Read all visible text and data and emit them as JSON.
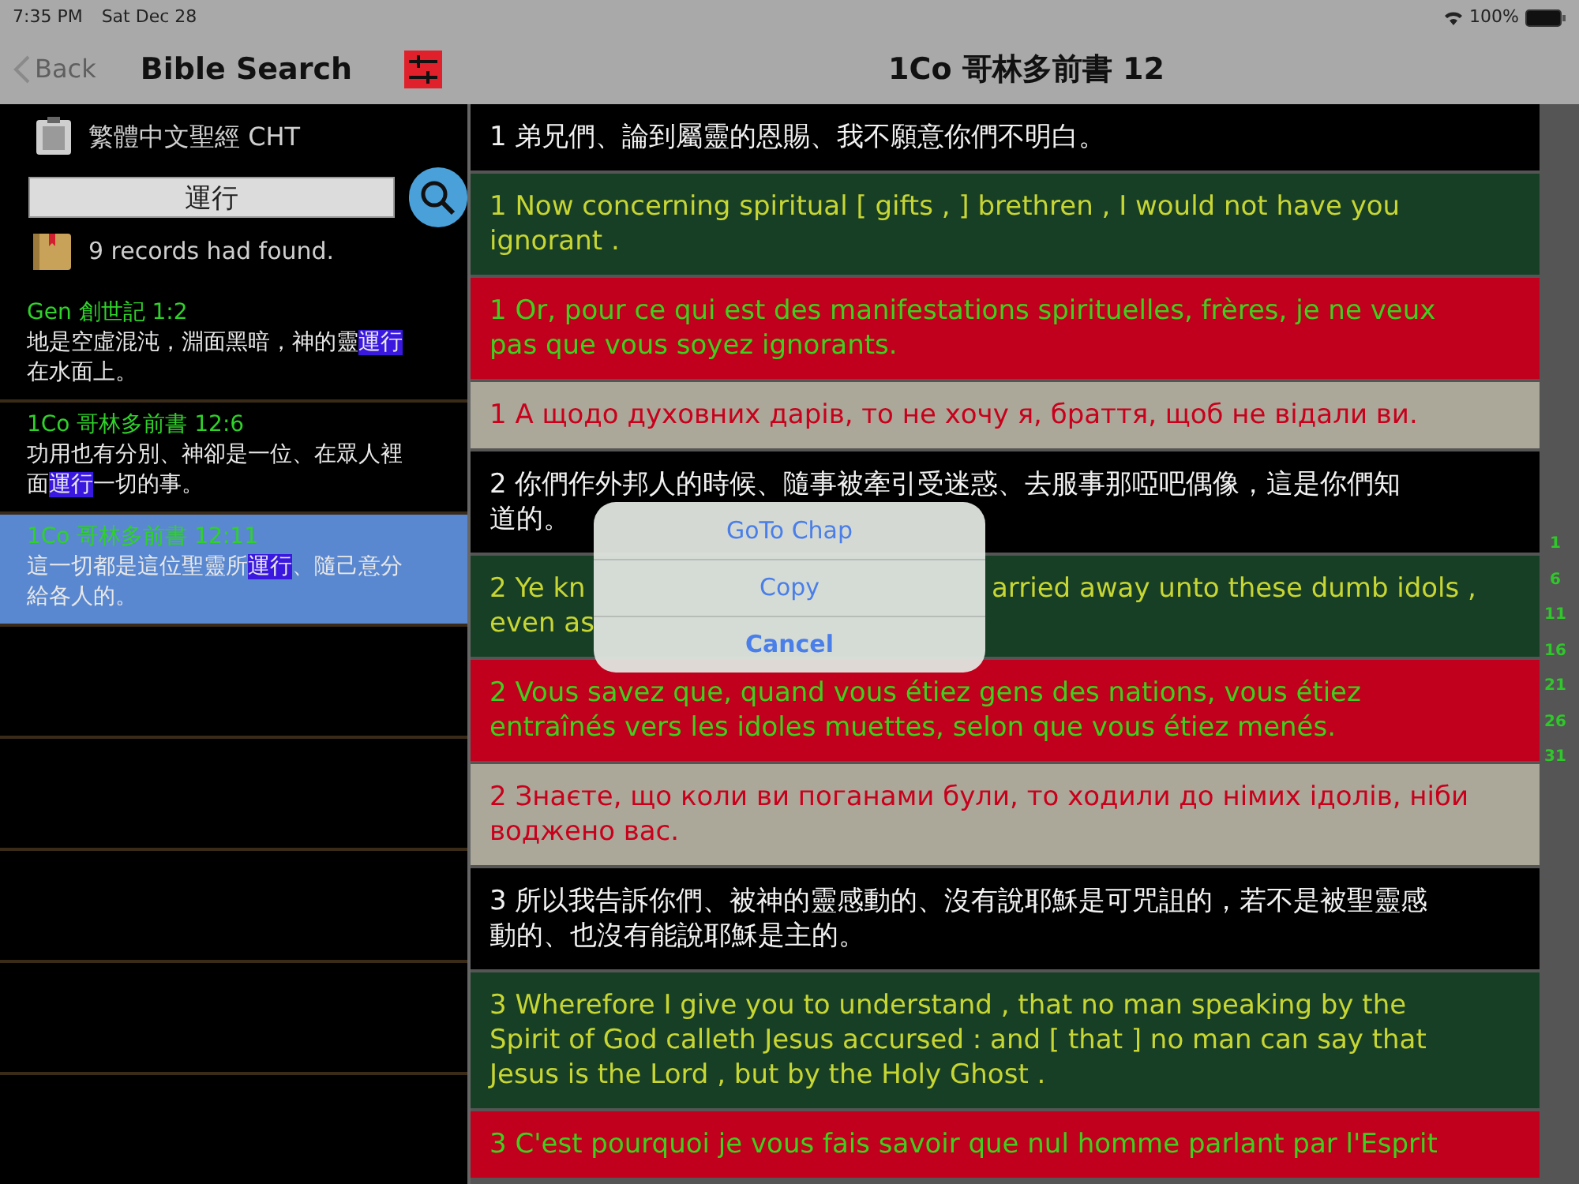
{
  "status_bar": {
    "time": "7:35 PM",
    "date": "Sat Dec 28",
    "battery": "100%"
  },
  "sidebar": {
    "back": "Back",
    "title": "Bible Search",
    "version": "繁體中文聖經 CHT",
    "search": {
      "value": "運行"
    },
    "records": "9 records had found.",
    "results": [
      {
        "ref": "Gen 創世記 1:2",
        "before": "地是空虛混沌，淵面黑暗，神的靈",
        "match": "運行",
        "after": "在水面上。",
        "selected": false
      },
      {
        "ref": "1Co 哥林多前書 12:6",
        "before": "功用也有分別、神卻是一位、在眾人裡面",
        "match": "運行",
        "after": "一切的事。",
        "selected": false
      },
      {
        "ref": "1Co 哥林多前書 12:11",
        "before": "這一切都是這位聖靈所",
        "match": "運行",
        "after": "、隨己意分給各人的。",
        "selected": true
      }
    ]
  },
  "reader": {
    "title": "1Co 哥林多前書 12",
    "verses": [
      {
        "kind": "chinese",
        "lines": [
          [
            "1 弟兄們、論到屬靈的恩賜、我不願意你們不明白。"
          ]
        ]
      },
      {
        "kind": "english",
        "lines": [
          [
            "1 Now concerning spiritual [ gifts , ] brethren , I would not have you"
          ],
          [
            "ignorant ."
          ]
        ]
      },
      {
        "kind": "french",
        "lines": [
          [
            "1 Or, pour ce qui est des manifestations spirituelles, frères, je ne veux"
          ],
          [
            "pas que vous soyez ignorants."
          ]
        ]
      },
      {
        "kind": "ukrainian",
        "lines": [
          [
            "1 А щодо духовних дарів, то не хочу я, браття, щоб не відали ви."
          ]
        ]
      },
      {
        "kind": "chinese",
        "lines": [
          [
            "2 你們作外邦人的時候、隨事被牽引受迷惑、去服事那啞吧偶像，這是你們知"
          ],
          [
            "道的。"
          ]
        ]
      },
      {
        "kind": "english",
        "lines": [
          [
            "2 Ye kn",
            "arried away unto these dumb idols ,"
          ],
          [
            "even as"
          ]
        ]
      },
      {
        "kind": "french",
        "lines": [
          [
            "2 Vous savez que, quand vous étiez gens des nations, vous étiez"
          ],
          [
            "entraînés vers les idoles muettes, selon que vous étiez menés."
          ]
        ]
      },
      {
        "kind": "ukrainian",
        "lines": [
          [
            "2 Знаєте, що коли ви поганами були, то ходили до німих ідолів, ніби"
          ],
          [
            "воджено вас."
          ]
        ]
      },
      {
        "kind": "chinese",
        "lines": [
          [
            "3 所以我告訴你們、被神的靈感動的、沒有說耶穌是可咒詛的，若不是被聖靈感"
          ],
          [
            "動的、也沒有能說耶穌是主的。"
          ]
        ]
      },
      {
        "kind": "english",
        "lines": [
          [
            "3 Wherefore I give you to understand , that no man speaking by the"
          ],
          [
            "Spirit of God calleth Jesus accursed : and [ that ] no man can say that"
          ],
          [
            "Jesus is the Lord , but by the Holy Ghost ."
          ]
        ]
      },
      {
        "kind": "french",
        "lines": [
          [
            "3 C'est pourquoi je vous fais savoir que nul homme parlant par l'Esprit"
          ]
        ]
      }
    ],
    "index": [
      "1",
      "6",
      "11",
      "16",
      "21",
      "26",
      "31"
    ]
  },
  "action_sheet": [
    "GoTo Chap",
    "Copy",
    "Cancel"
  ]
}
